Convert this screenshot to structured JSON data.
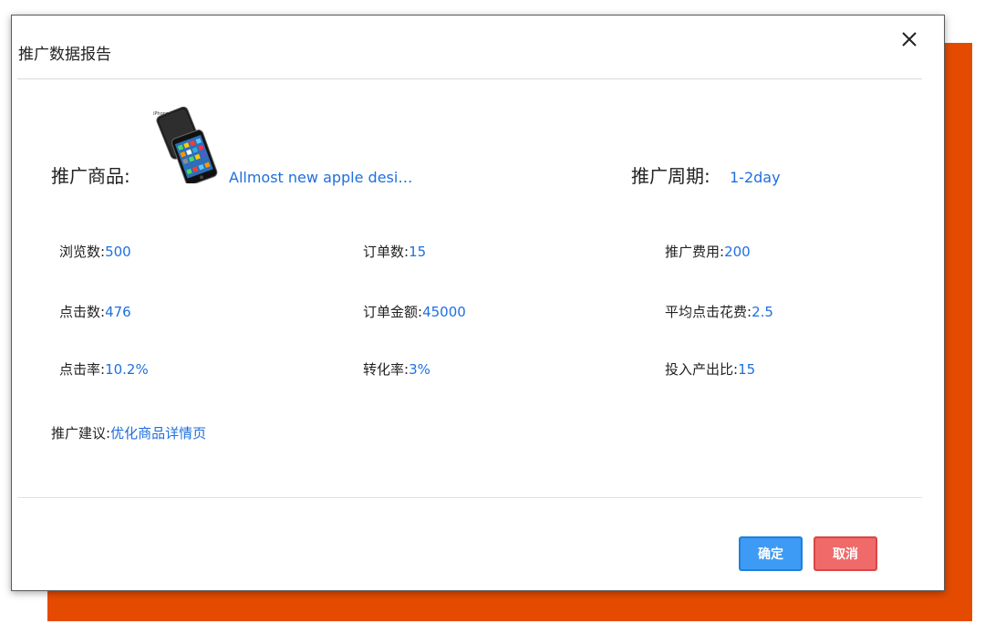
{
  "dialog": {
    "title": "推广数据报告"
  },
  "product": {
    "label": "推广商品:",
    "name": "Allmost new apple desi…"
  },
  "period": {
    "label": "推广周期:",
    "value": "1-2day"
  },
  "stats": {
    "views": {
      "label": "浏览数:",
      "value": "500"
    },
    "orders": {
      "label": "订单数:",
      "value": "15"
    },
    "cost": {
      "label": "推广费用:",
      "value": "200"
    },
    "clicks": {
      "label": "点击数:",
      "value": "476"
    },
    "order_amount": {
      "label": "订单金额:",
      "value": "45000"
    },
    "avg_click_cost": {
      "label": "平均点击花费:",
      "value": "2.5"
    },
    "ctr": {
      "label": "点击率:",
      "value": "10.2%"
    },
    "conversion": {
      "label": "转化率:",
      "value": "3%"
    },
    "roi": {
      "label": "投入产出比:",
      "value": "15"
    },
    "suggestion": {
      "label": "推广建议:",
      "value": "优化商品详情页"
    }
  },
  "buttons": {
    "confirm": "确定",
    "cancel": "取消"
  },
  "icons": {
    "close": "close-icon",
    "product": "phone-product-image"
  },
  "colors": {
    "backdrop": "#e54b00",
    "value_text": "#1f6fe0",
    "confirm_button": "#3d9bf5",
    "cancel_button": "#f06a6a"
  }
}
